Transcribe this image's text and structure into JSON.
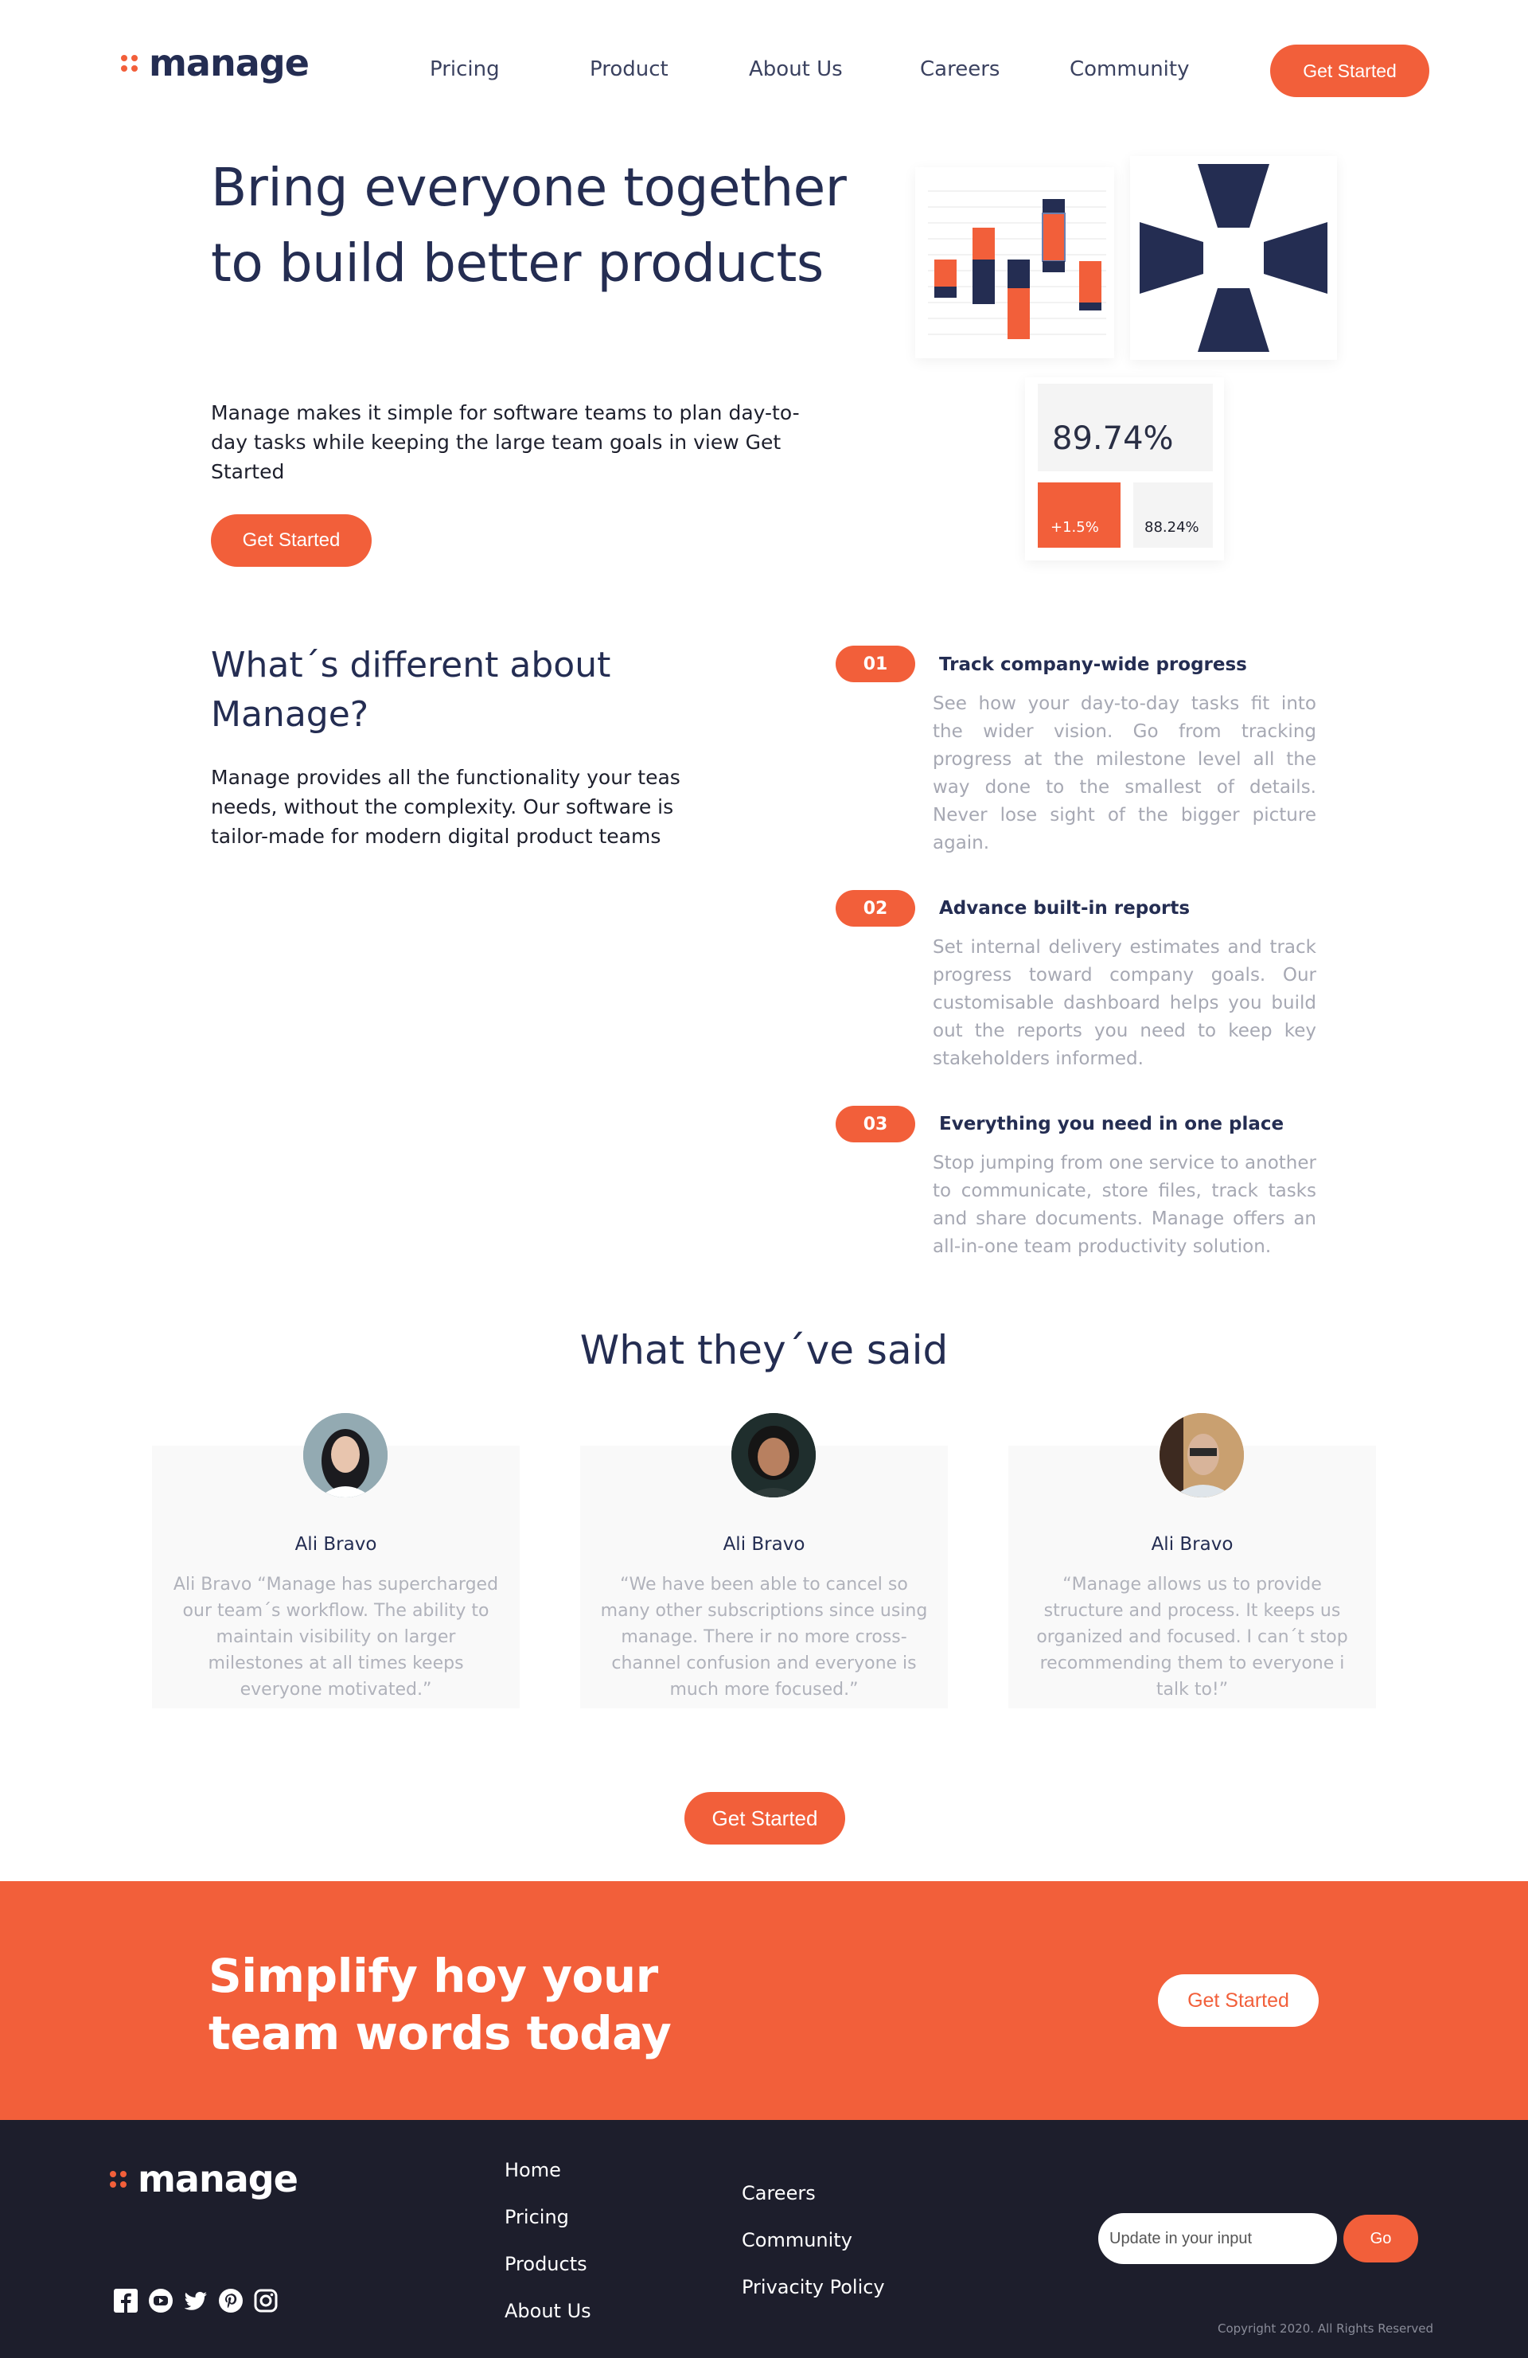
{
  "header": {
    "logo_text": "manage",
    "nav": [
      "Pricing",
      "Product",
      "About Us",
      "Careers",
      "Community"
    ],
    "cta_label": "Get Started"
  },
  "hero": {
    "title": "Bring everyone together to build better products",
    "text": "Manage makes it simple for software teams to plan day-to-day tasks while keeping the large team goals in view Get Started",
    "cta_label": "Get Started"
  },
  "stats": {
    "main_value": "89.74%",
    "change_value": "+1.5%",
    "secondary_value": "88.24%"
  },
  "features": {
    "title": "What´s different about Manage?",
    "text": "Manage provides all the functionality your teas needs, without the complexity. Our software is tailor-made for modern digital product teams",
    "items": [
      {
        "number": "01",
        "title": "Track company-wide progress",
        "text": "See how your day-to-day tasks fit into the wider vision. Go from tracking progress at the milestone level all the way done to the smallest of details. Never lose sight of the bigger picture again."
      },
      {
        "number": "02",
        "title": "Advance built-in reports",
        "text": "Set internal delivery estimates and track progress toward company goals. Our customisable dashboard helps you build out the reports you need to keep key stakeholders informed."
      },
      {
        "number": "03",
        "title": "Everything you need in one place",
        "text": "Stop jumping from one service to another to communicate, store files, track tasks and share documents. Manage offers an all-in-one team productivity solution."
      }
    ]
  },
  "testimonials": {
    "title": "What they´ve said",
    "items": [
      {
        "name": "Ali Bravo",
        "quote": "Ali Bravo “Manage has supercharged our team´s workflow. The ability to maintain visibility on larger milestones at all times keeps everyone motivated.”"
      },
      {
        "name": "Ali Bravo",
        "quote": "“We have been able to cancel so many other subscriptions since using manage. There ir no more cross-channel confusion and everyone is much more focused.”"
      },
      {
        "name": "Ali Bravo",
        "quote": "“Manage allows us to provide structure and process. It keeps us organized and focused. I can´t stop recommending them to everyone i talk to!”"
      }
    ],
    "cta_label": "Get Started"
  },
  "cta": {
    "title": "Simplify hoy your team words today",
    "button_label": "Get Started"
  },
  "footer": {
    "logo_text": "manage",
    "links_col1": [
      "Home",
      "Pricing",
      "Products",
      "About Us"
    ],
    "links_col2": [
      "Careers",
      "Community",
      "Privacity Policy"
    ],
    "input_placeholder": "Update in your input",
    "go_label": "Go",
    "copyright": "Copyright 2020. All Rights Reserved",
    "social_icons": [
      "facebook-icon",
      "youtube-icon",
      "twitter-icon",
      "pinterest-icon",
      "instagram-icon"
    ]
  },
  "colors": {
    "accent": "#f25f3a",
    "navy": "#242d52",
    "footer_bg": "#1d1e2c"
  }
}
